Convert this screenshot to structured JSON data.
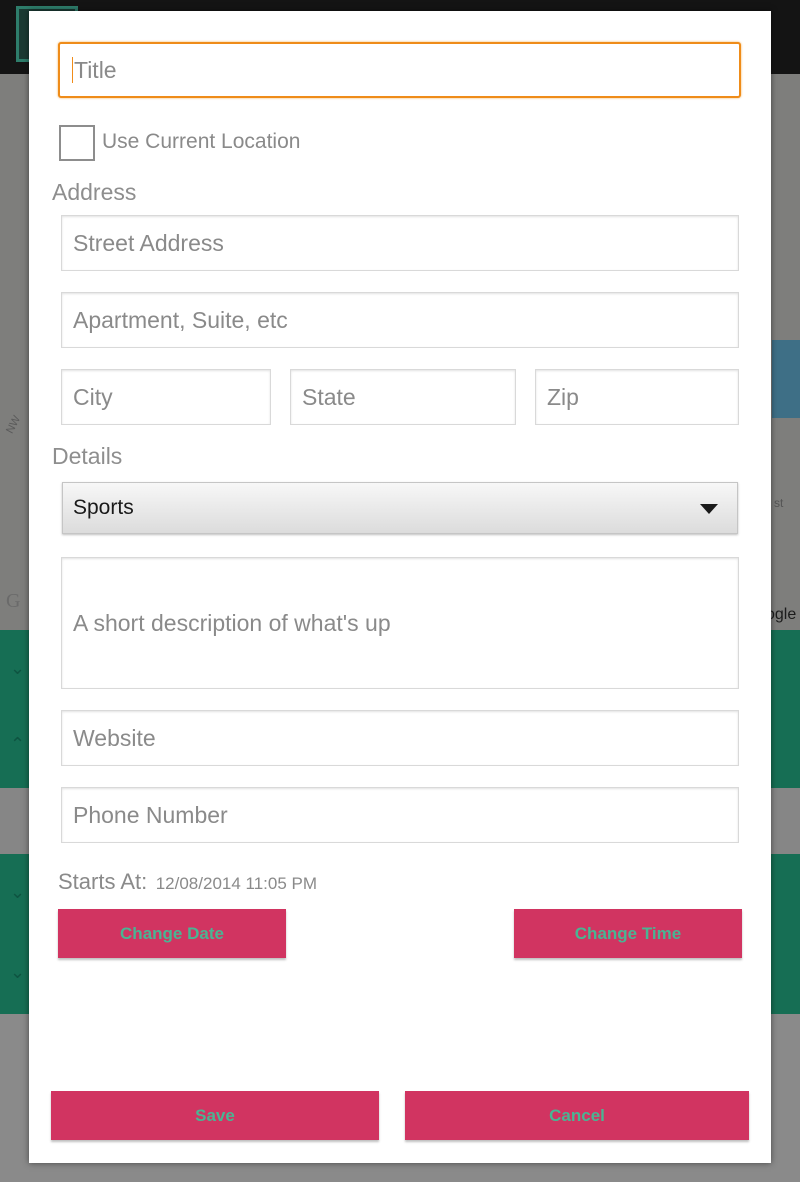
{
  "form": {
    "title_placeholder": "Title",
    "use_current_location_label": "Use Current Location",
    "address_heading": "Address",
    "street_placeholder": "Street Address",
    "apartment_placeholder": "Apartment, Suite, etc",
    "city_placeholder": "City",
    "state_placeholder": "State",
    "zip_placeholder": "Zip",
    "details_heading": "Details",
    "category_selected": "Sports",
    "description_placeholder": "A short description of what's up",
    "website_placeholder": "Website",
    "phone_placeholder": "Phone Number",
    "starts_at_label": "Starts At:",
    "starts_at_value": "12/08/2014 11:05 PM",
    "change_date_label": "Change Date",
    "change_time_label": "Change Time",
    "save_label": "Save",
    "cancel_label": "Cancel"
  },
  "background": {
    "map_street_label": "NW",
    "map_street_suffix": "st",
    "map_attribution_left": "G",
    "map_attribution_right": "ogle"
  },
  "colors": {
    "accent_focus": "#ef8c19",
    "button_bg": "#d13461",
    "button_text": "#4ab493",
    "background_teal": "#166e54"
  }
}
